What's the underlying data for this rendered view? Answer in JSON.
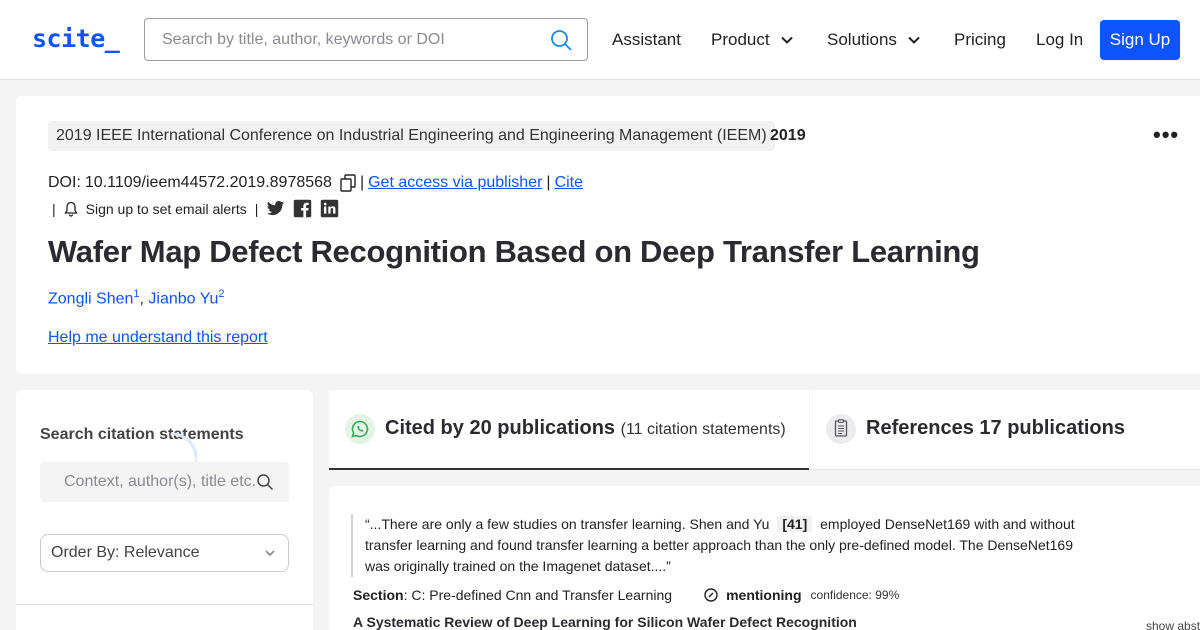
{
  "header": {
    "logo": "scite_",
    "search_placeholder": "Search by title, author, keywords or DOI",
    "nav": {
      "assistant": "Assistant",
      "product": "Product",
      "solutions": "Solutions",
      "pricing": "Pricing",
      "login": "Log In",
      "signup": "Sign Up"
    }
  },
  "report": {
    "venue": "2019 IEEE International Conference on Industrial Engineering and Engineering Management (IEEM)",
    "year": "2019",
    "doi_label": "DOI:",
    "doi": "10.1109/ieem44572.2019.8978568",
    "access_link": "Get access via publisher",
    "cite_link": "Cite",
    "alert_text": "Sign up to set email alerts",
    "title": "Wafer Map Defect Recognition Based on Deep Transfer Learning",
    "authors": [
      {
        "name": "Zongli Shen",
        "sup": "1"
      },
      {
        "name": "Jianbo Yu",
        "sup": "2"
      }
    ],
    "help_link": "Help me understand this report"
  },
  "sidebar": {
    "title": "Search citation statements",
    "search_placeholder": "Context, author(s), title etc.",
    "order_by": "Order By: Relevance"
  },
  "tabs": {
    "cited": {
      "label": "Cited by 20 publications",
      "sub": "(11 citation statements)"
    },
    "references": {
      "label": "References 17 publications"
    }
  },
  "citation": {
    "quote_before": "“...There are only a few studies on transfer learning. Shen and Yu",
    "ref": "[41]",
    "quote_after": "employed DenseNet169 with and without transfer learning and found transfer learning a better approach than the only pre-defined model. The DenseNet169 was originally trained on the Imagenet dataset....”",
    "section_label": "Section",
    "section_value": ": C: Pre-defined Cnn and Transfer Learning",
    "type": "mentioning",
    "confidence": "confidence: 99%",
    "paper_title": "A Systematic Review of Deep Learning for Silicon Wafer Defect Recognition",
    "show_abstract": "show abst"
  },
  "colors": {
    "accent": "#0f52ff",
    "background": "#f4f4f5",
    "card": "#ffffff",
    "cited_icon": "#3aa757"
  }
}
